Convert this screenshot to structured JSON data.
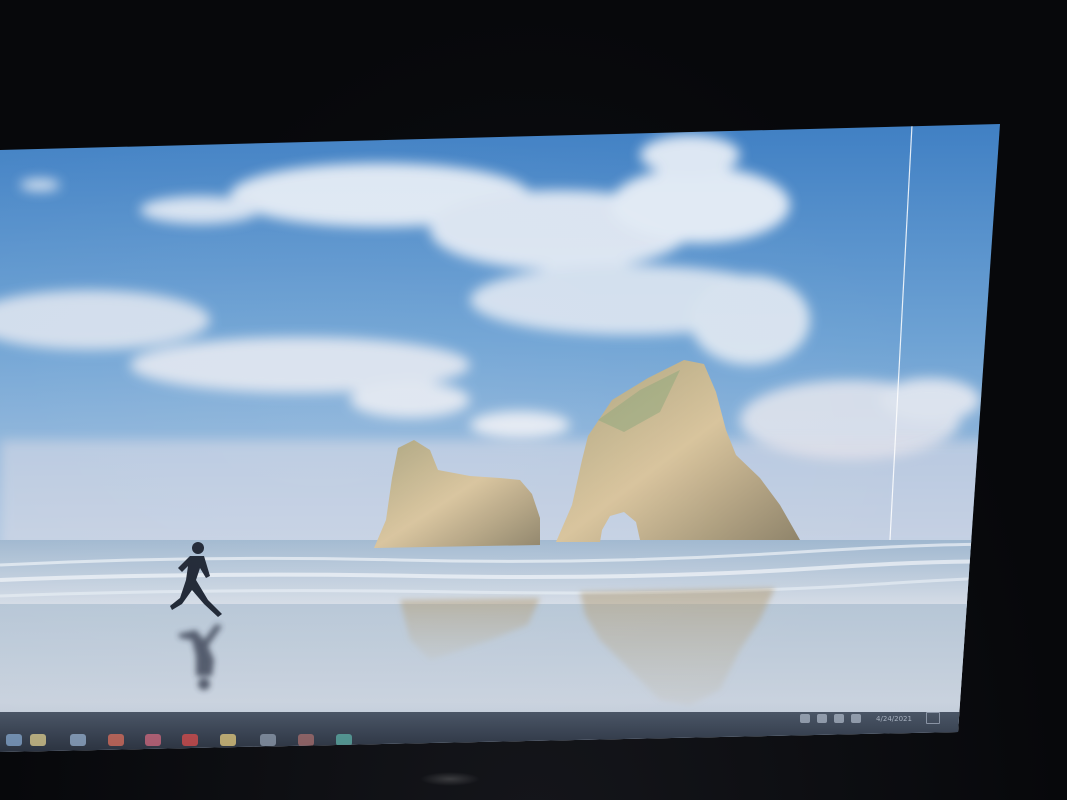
{
  "desktop": {
    "wallpaper": "beach-rock-arch-runner",
    "colors": {
      "sky_top": "#3e7fc4",
      "sky_mid": "#8db8dd",
      "horizon": "#d7d9e6",
      "sand": "#c9d2de",
      "rock": "#c8b58f"
    }
  },
  "taskbar": {
    "pinned": [
      {
        "icon": "start-icon",
        "color": "#7fa0c6"
      },
      {
        "icon": "file-explorer-icon",
        "color": "#d3c48a"
      },
      {
        "icon": "search-icon",
        "color": "#8fa8c6"
      },
      {
        "icon": "chrome-icon",
        "color": "#d06a5a"
      },
      {
        "icon": "app-icon",
        "color": "#c7657a"
      },
      {
        "icon": "media-icon",
        "color": "#d04b4b"
      },
      {
        "icon": "folder-icon",
        "color": "#d9c27a"
      },
      {
        "icon": "app-icon",
        "color": "#8a96a8"
      },
      {
        "icon": "terminal-icon",
        "color": "#a06a6a"
      },
      {
        "icon": "app-icon",
        "color": "#5aa7a0"
      }
    ],
    "tray": {
      "icons": [
        "chevron-up-icon",
        "battery-icon",
        "network-icon",
        "volume-icon",
        "keyboard-icon"
      ],
      "time": "6:59 PM",
      "date": "4/24/2021"
    }
  }
}
